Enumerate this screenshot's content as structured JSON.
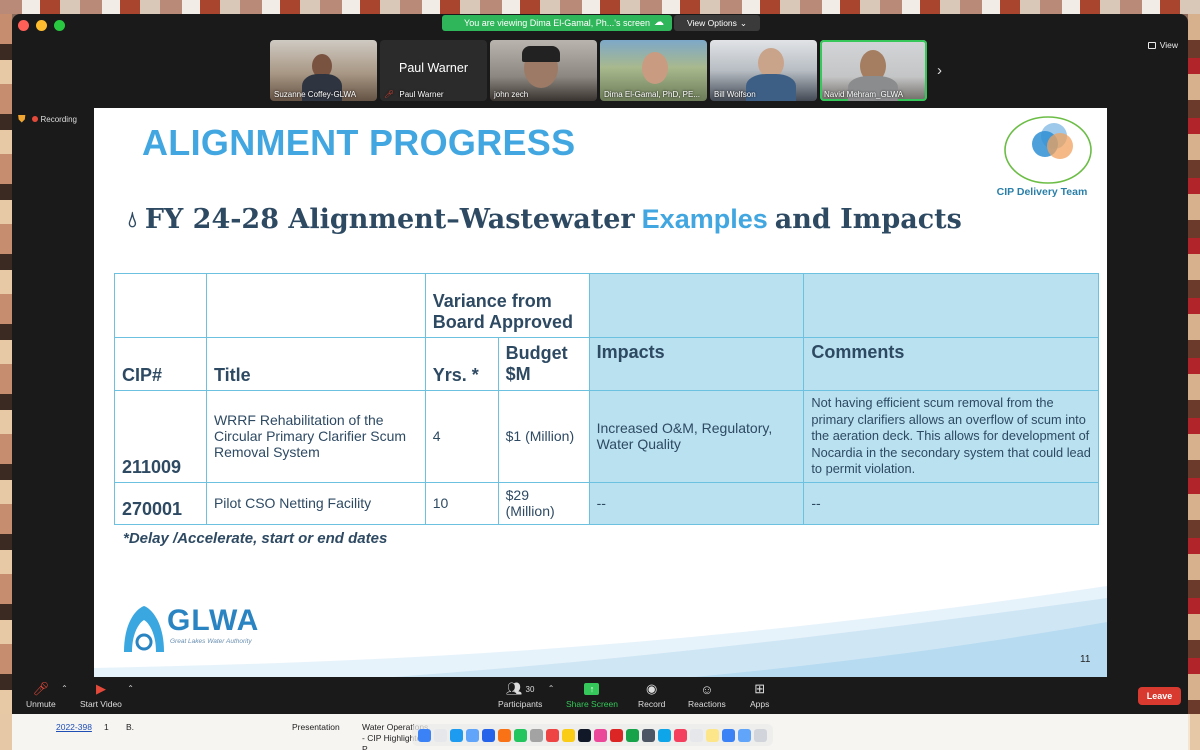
{
  "share_banner": {
    "text": "You are viewing Dima El-Gamal, Ph...'s screen",
    "view_options": "View Options"
  },
  "top_right": {
    "view_label": "View"
  },
  "participants": [
    {
      "name": "Suzanne Coffey-GLWA",
      "muted": false,
      "video": true
    },
    {
      "name": "Paul Warner",
      "muted": true,
      "video": false,
      "display_name": "Paul Warner"
    },
    {
      "name": "john zech",
      "muted": false,
      "video": true
    },
    {
      "name": "Dima El-Gamal, PhD, PE...",
      "muted": false,
      "video": true
    },
    {
      "name": "Bill Wolfson",
      "muted": false,
      "video": true
    },
    {
      "name": "Navid Mehram_GLWA",
      "muted": false,
      "video": true,
      "active_speaker": true
    }
  ],
  "recording": {
    "label": "Recording"
  },
  "slide": {
    "title": "ALIGNMENT PROGRESS",
    "cip_team_label": "CIP Delivery Team",
    "subtitle_part1": "FY 24-28 Alignment–Wastewater",
    "subtitle_highlight": "Examples",
    "subtitle_part2": "and Impacts",
    "table": {
      "group_header": "Variance from Board Approved",
      "headers": {
        "cip": "CIP#",
        "title": "Title",
        "yrs": "Yrs. *",
        "budget": "Budget $M",
        "impacts": "Impacts",
        "comments": "Comments"
      },
      "rows": [
        {
          "cip": "211009",
          "title": "WRRF Rehabilitation of the Circular Primary Clarifier Scum Removal System",
          "yrs": "4",
          "budget": "$1 (Million)",
          "impacts": "Increased O&M, Regulatory, Water Quality",
          "comments": "Not having efficient scum removal from the primary clarifiers allows an overflow of scum into the aeration deck. This allows for development of Nocardia in the secondary system that could lead to permit violation."
        },
        {
          "cip": "270001",
          "title": "Pilot CSO Netting Facility",
          "yrs": "10",
          "budget": "$29 (Million)",
          "impacts": "--",
          "comments": "--"
        }
      ]
    },
    "footnote": "*Delay /Accelerate, start or end dates",
    "org_logo_text": "GLWA",
    "org_logo_sub": "Great Lakes Water Authority",
    "page_number": "11"
  },
  "controls": {
    "unmute": "Unmute",
    "start_video": "Start Video",
    "participants": "Participants",
    "participant_count": "30",
    "share_screen": "Share Screen",
    "record": "Record",
    "reactions": "Reactions",
    "apps": "Apps",
    "leave": "Leave"
  },
  "background_doc": {
    "row_id": "2022-398",
    "row_num": "1",
    "row_initial": "B.",
    "row_type": "Presentation",
    "row_title": "Water Operations - CIP Highlighted P..."
  },
  "colors": {
    "title_blue": "#42a7e0",
    "navy_text": "#2e4a63",
    "table_border": "#6cc0e0",
    "table_shade": "#b9e1ef",
    "share_green": "#35c759",
    "leave_red": "#d93a30"
  }
}
